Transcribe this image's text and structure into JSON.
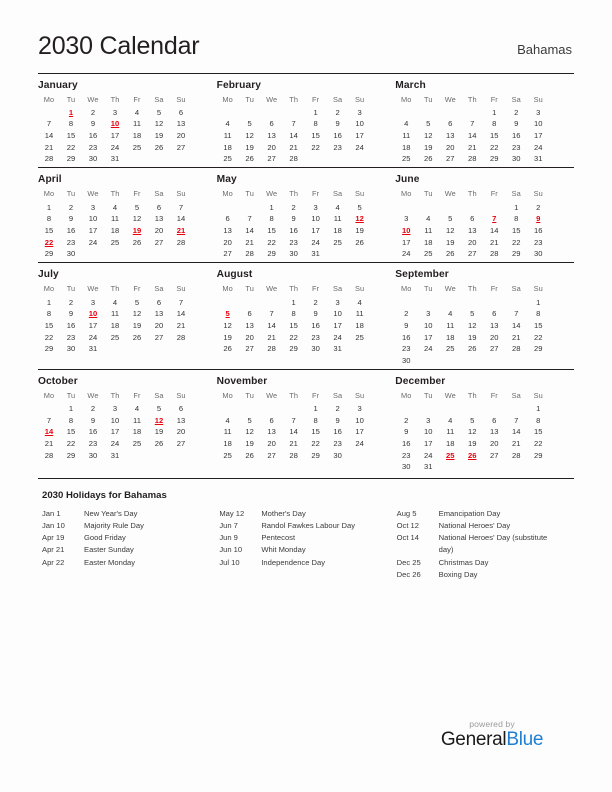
{
  "header": {
    "title": "2030 Calendar",
    "country": "Bahamas"
  },
  "weekday_headers": [
    "Mo",
    "Tu",
    "We",
    "Th",
    "Fr",
    "Sa",
    "Su"
  ],
  "holiday_color": "#e8000d",
  "months": [
    {
      "name": "January",
      "weeks": [
        [
          "",
          "1",
          "2",
          "3",
          "4",
          "5",
          "6"
        ],
        [
          "7",
          "8",
          "9",
          "10",
          "11",
          "12",
          "13"
        ],
        [
          "14",
          "15",
          "16",
          "17",
          "18",
          "19",
          "20"
        ],
        [
          "21",
          "22",
          "23",
          "24",
          "25",
          "26",
          "27"
        ],
        [
          "28",
          "29",
          "30",
          "31",
          "",
          "",
          ""
        ]
      ],
      "holidays": [
        "1",
        "10"
      ]
    },
    {
      "name": "February",
      "weeks": [
        [
          "",
          "",
          "",
          "",
          "1",
          "2",
          "3"
        ],
        [
          "4",
          "5",
          "6",
          "7",
          "8",
          "9",
          "10"
        ],
        [
          "11",
          "12",
          "13",
          "14",
          "15",
          "16",
          "17"
        ],
        [
          "18",
          "19",
          "20",
          "21",
          "22",
          "23",
          "24"
        ],
        [
          "25",
          "26",
          "27",
          "28",
          "",
          "",
          ""
        ]
      ],
      "holidays": []
    },
    {
      "name": "March",
      "weeks": [
        [
          "",
          "",
          "",
          "",
          "1",
          "2",
          "3"
        ],
        [
          "4",
          "5",
          "6",
          "7",
          "8",
          "9",
          "10"
        ],
        [
          "11",
          "12",
          "13",
          "14",
          "15",
          "16",
          "17"
        ],
        [
          "18",
          "19",
          "20",
          "21",
          "22",
          "23",
          "24"
        ],
        [
          "25",
          "26",
          "27",
          "28",
          "29",
          "30",
          "31"
        ]
      ],
      "holidays": []
    },
    {
      "name": "April",
      "weeks": [
        [
          "1",
          "2",
          "3",
          "4",
          "5",
          "6",
          "7"
        ],
        [
          "8",
          "9",
          "10",
          "11",
          "12",
          "13",
          "14"
        ],
        [
          "15",
          "16",
          "17",
          "18",
          "19",
          "20",
          "21"
        ],
        [
          "22",
          "23",
          "24",
          "25",
          "26",
          "27",
          "28"
        ],
        [
          "29",
          "30",
          "",
          "",
          "",
          "",
          ""
        ]
      ],
      "holidays": [
        "19",
        "21",
        "22"
      ]
    },
    {
      "name": "May",
      "weeks": [
        [
          "",
          "",
          "1",
          "2",
          "3",
          "4",
          "5"
        ],
        [
          "6",
          "7",
          "8",
          "9",
          "10",
          "11",
          "12"
        ],
        [
          "13",
          "14",
          "15",
          "16",
          "17",
          "18",
          "19"
        ],
        [
          "20",
          "21",
          "22",
          "23",
          "24",
          "25",
          "26"
        ],
        [
          "27",
          "28",
          "29",
          "30",
          "31",
          "",
          ""
        ]
      ],
      "holidays": [
        "12"
      ]
    },
    {
      "name": "June",
      "weeks": [
        [
          "",
          "",
          "",
          "",
          "",
          "1",
          "2"
        ],
        [
          "3",
          "4",
          "5",
          "6",
          "7",
          "8",
          "9"
        ],
        [
          "10",
          "11",
          "12",
          "13",
          "14",
          "15",
          "16"
        ],
        [
          "17",
          "18",
          "19",
          "20",
          "21",
          "22",
          "23"
        ],
        [
          "24",
          "25",
          "26",
          "27",
          "28",
          "29",
          "30"
        ]
      ],
      "holidays": [
        "7",
        "9",
        "10"
      ]
    },
    {
      "name": "July",
      "weeks": [
        [
          "1",
          "2",
          "3",
          "4",
          "5",
          "6",
          "7"
        ],
        [
          "8",
          "9",
          "10",
          "11",
          "12",
          "13",
          "14"
        ],
        [
          "15",
          "16",
          "17",
          "18",
          "19",
          "20",
          "21"
        ],
        [
          "22",
          "23",
          "24",
          "25",
          "26",
          "27",
          "28"
        ],
        [
          "29",
          "30",
          "31",
          "",
          "",
          "",
          ""
        ]
      ],
      "holidays": [
        "10"
      ]
    },
    {
      "name": "August",
      "weeks": [
        [
          "",
          "",
          "",
          "1",
          "2",
          "3",
          "4"
        ],
        [
          "5",
          "6",
          "7",
          "8",
          "9",
          "10",
          "11"
        ],
        [
          "12",
          "13",
          "14",
          "15",
          "16",
          "17",
          "18"
        ],
        [
          "19",
          "20",
          "21",
          "22",
          "23",
          "24",
          "25"
        ],
        [
          "26",
          "27",
          "28",
          "29",
          "30",
          "31",
          ""
        ]
      ],
      "holidays": [
        "5"
      ]
    },
    {
      "name": "September",
      "weeks": [
        [
          "",
          "",
          "",
          "",
          "",
          "",
          "1"
        ],
        [
          "2",
          "3",
          "4",
          "5",
          "6",
          "7",
          "8"
        ],
        [
          "9",
          "10",
          "11",
          "12",
          "13",
          "14",
          "15"
        ],
        [
          "16",
          "17",
          "18",
          "19",
          "20",
          "21",
          "22"
        ],
        [
          "23",
          "24",
          "25",
          "26",
          "27",
          "28",
          "29"
        ],
        [
          "30",
          "",
          "",
          "",
          "",
          "",
          ""
        ]
      ],
      "holidays": []
    },
    {
      "name": "October",
      "weeks": [
        [
          "",
          "1",
          "2",
          "3",
          "4",
          "5",
          "6"
        ],
        [
          "7",
          "8",
          "9",
          "10",
          "11",
          "12",
          "13"
        ],
        [
          "14",
          "15",
          "16",
          "17",
          "18",
          "19",
          "20"
        ],
        [
          "21",
          "22",
          "23",
          "24",
          "25",
          "26",
          "27"
        ],
        [
          "28",
          "29",
          "30",
          "31",
          "",
          "",
          ""
        ]
      ],
      "holidays": [
        "12",
        "14"
      ]
    },
    {
      "name": "November",
      "weeks": [
        [
          "",
          "",
          "",
          "",
          "1",
          "2",
          "3"
        ],
        [
          "4",
          "5",
          "6",
          "7",
          "8",
          "9",
          "10"
        ],
        [
          "11",
          "12",
          "13",
          "14",
          "15",
          "16",
          "17"
        ],
        [
          "18",
          "19",
          "20",
          "21",
          "22",
          "23",
          "24"
        ],
        [
          "25",
          "26",
          "27",
          "28",
          "29",
          "30",
          ""
        ]
      ],
      "holidays": []
    },
    {
      "name": "December",
      "weeks": [
        [
          "",
          "",
          "",
          "",
          "",
          "",
          "1"
        ],
        [
          "2",
          "3",
          "4",
          "5",
          "6",
          "7",
          "8"
        ],
        [
          "9",
          "10",
          "11",
          "12",
          "13",
          "14",
          "15"
        ],
        [
          "16",
          "17",
          "18",
          "19",
          "20",
          "21",
          "22"
        ],
        [
          "23",
          "24",
          "25",
          "26",
          "27",
          "28",
          "29"
        ],
        [
          "30",
          "31",
          "",
          "",
          "",
          "",
          ""
        ]
      ],
      "holidays": [
        "25",
        "26"
      ]
    }
  ],
  "holidays_section": {
    "title": "2030 Holidays for Bahamas",
    "columns": [
      [
        {
          "date": "Jan 1",
          "name": "New Year's Day"
        },
        {
          "date": "Jan 10",
          "name": "Majority Rule Day"
        },
        {
          "date": "Apr 19",
          "name": "Good Friday"
        },
        {
          "date": "Apr 21",
          "name": "Easter Sunday"
        },
        {
          "date": "Apr 22",
          "name": "Easter Monday"
        }
      ],
      [
        {
          "date": "May 12",
          "name": "Mother's Day"
        },
        {
          "date": "Jun 7",
          "name": "Randol Fawkes Labour Day"
        },
        {
          "date": "Jun 9",
          "name": "Pentecost"
        },
        {
          "date": "Jun 10",
          "name": "Whit Monday"
        },
        {
          "date": "Jul 10",
          "name": "Independence Day"
        }
      ],
      [
        {
          "date": "Aug 5",
          "name": "Emancipation Day"
        },
        {
          "date": "Oct 12",
          "name": "National Heroes' Day"
        },
        {
          "date": "Oct 14",
          "name": "National Heroes' Day (substitute day)"
        },
        {
          "date": "Dec 25",
          "name": "Christmas Day"
        },
        {
          "date": "Dec 26",
          "name": "Boxing Day"
        }
      ]
    ]
  },
  "footer": {
    "powered_by": "powered by",
    "brand_first": "General",
    "brand_second": "Blue",
    "brand_accent_color": "#1d7fd4"
  }
}
